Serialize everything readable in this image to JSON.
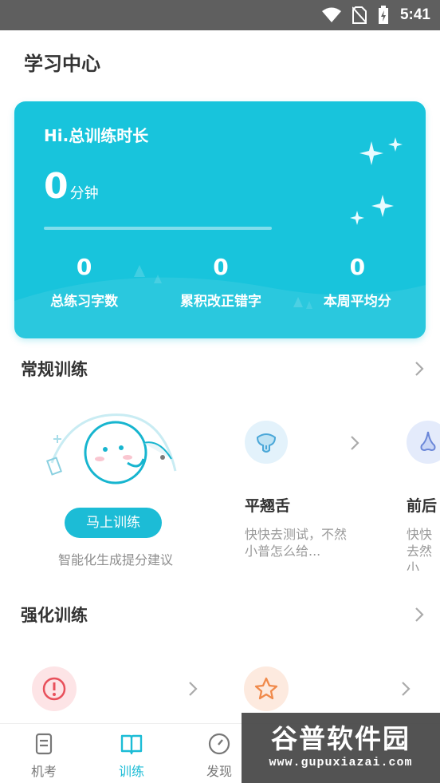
{
  "status_bar": {
    "time": "5:41"
  },
  "page": {
    "title": "学习中心"
  },
  "hero": {
    "title": "Hi.总训练时长",
    "minutes_value": "0",
    "minutes_unit": "分钟",
    "progress": 0,
    "stats": [
      {
        "value": "0",
        "label": "总练习字数"
      },
      {
        "value": "0",
        "label": "累积改正错字"
      },
      {
        "value": "0",
        "label": "本周平均分"
      }
    ]
  },
  "regular": {
    "title": "常规训练",
    "main_card": {
      "button": "马上训练",
      "subtitle": "智能化生成提分建议"
    },
    "cards": [
      {
        "icon": "tongue-icon",
        "title": "平翘舌",
        "desc": "快快去测试，不然小普怎么给..."
      },
      {
        "icon": "nose-icon",
        "title": "前后",
        "desc": "快快去然小"
      }
    ]
  },
  "intensive": {
    "title": "强化训练",
    "cards": [
      {
        "icon": "alert-icon"
      },
      {
        "icon": "star-icon"
      }
    ]
  },
  "bottom_nav": {
    "items": [
      {
        "label": "机考",
        "icon": "exam-icon"
      },
      {
        "label": "训练",
        "icon": "book-icon",
        "active": true
      },
      {
        "label": "发现",
        "icon": "compass-icon"
      }
    ]
  },
  "watermark": {
    "logo": "谷普软件园",
    "url": "www.gupuxiazai.com"
  },
  "colors": {
    "accent": "#18c4dc",
    "status_bar": "#5f5f5f"
  }
}
